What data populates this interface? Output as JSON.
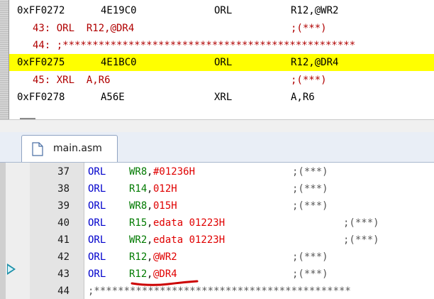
{
  "disassembly": {
    "lines": [
      {
        "kind": "asm",
        "addr": "0xFF0272",
        "code": "4E19C0",
        "mnem": "ORL",
        "ops": "R12,@WR2",
        "highlight": false
      },
      {
        "kind": "src",
        "text": "43: ORL  R12,@DR4",
        "comment": ";(***)"
      },
      {
        "kind": "src",
        "text": "44: ;*************************************************",
        "comment": ""
      },
      {
        "kind": "asm",
        "addr": "0xFF0275",
        "code": "4E1BC0",
        "mnem": "ORL",
        "ops": "R12,@DR4",
        "highlight": true
      },
      {
        "kind": "src",
        "text": "45: XRL  A,R6",
        "comment": ";(***)"
      },
      {
        "kind": "asm",
        "addr": "0xFF0278",
        "code": "A56E",
        "mnem": "XRL",
        "ops": "A,R6",
        "highlight": false
      }
    ],
    "highlight_color": "#ffff00"
  },
  "tab": {
    "label": "main.asm",
    "icon": "file-icon"
  },
  "editor": {
    "current_line_marker": "arrow-right-icon",
    "lines": [
      {
        "num": "37",
        "mnem": "ORL",
        "reg": "WR8",
        "sep": ",",
        "val": "#01236H",
        "comment": ";(***)",
        "ccol": "n"
      },
      {
        "num": "38",
        "mnem": "ORL",
        "reg": "R14",
        "sep": ",",
        "val": "012H",
        "comment": ";(***)",
        "ccol": "n"
      },
      {
        "num": "39",
        "mnem": "ORL",
        "reg": "WR8",
        "sep": ",",
        "val": "015H",
        "comment": ";(***)",
        "ccol": "n"
      },
      {
        "num": "40",
        "mnem": "ORL",
        "reg": "R15",
        "sep": ",",
        "val": "edata 01223H",
        "comment": ";(***)",
        "ccol": "w"
      },
      {
        "num": "41",
        "mnem": "ORL",
        "reg": "WR2",
        "sep": ",",
        "val": "edata 01223H",
        "comment": ";(***)",
        "ccol": "w"
      },
      {
        "num": "42",
        "mnem": "ORL",
        "reg": "R12",
        "sep": ",",
        "val": "@WR2",
        "comment": ";(***)",
        "ccol": "n"
      },
      {
        "num": "43",
        "mnem": "ORL",
        "reg": "R12",
        "sep": ",",
        "val": "@DR4",
        "comment": ";(***)",
        "ccol": "n"
      },
      {
        "num": "44",
        "mnem": "",
        "reg": "",
        "sep": "",
        "val": "",
        "comment": ";*******************************************",
        "ccol": "full"
      }
    ]
  },
  "annotation": {
    "color": "#cc0000"
  }
}
